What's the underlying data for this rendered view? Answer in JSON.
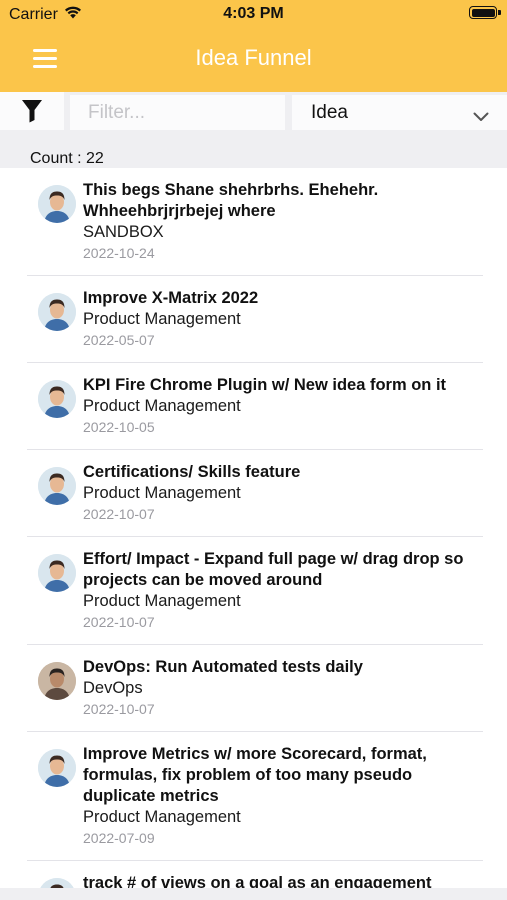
{
  "status_bar": {
    "carrier": "Carrier",
    "time": "4:03 PM"
  },
  "nav": {
    "title": "Idea Funnel",
    "menu_icon": "hamburger-menu-icon"
  },
  "filter": {
    "funnel_icon": "funnel-icon",
    "placeholder": "Filter...",
    "value": "",
    "type_selected": "Idea"
  },
  "count_text": "Count : 22",
  "ideas": [
    {
      "title": "This begs Shane shehrbrhs. Ehehehr. Whheehbrjrjrbejej where",
      "category": "SANDBOX",
      "date": "2022-10-24"
    },
    {
      "title": "Improve X-Matrix 2022",
      "category": "Product Management",
      "date": "2022-05-07"
    },
    {
      "title": "KPI Fire Chrome Plugin w/ New idea form on it",
      "category": "Product Management",
      "date": "2022-10-05"
    },
    {
      "title": "Certifications/ Skills feature",
      "category": "Product Management",
      "date": "2022-10-07"
    },
    {
      "title": "Effort/ Impact - Expand full page  w/ drag drop so projects can be moved around",
      "category": "Product Management",
      "date": "2022-10-07"
    },
    {
      "title": "DevOps: Run Automated tests daily",
      "category": "DevOps",
      "date": "2022-10-07"
    },
    {
      "title": "Improve Metrics w/ more Scorecard, format, formulas, fix problem of too many pseudo duplicate metrics",
      "category": "Product Management",
      "date": "2022-07-09"
    },
    {
      "title": "track # of views on a goal as an engagement",
      "category": "",
      "date": ""
    }
  ],
  "colors": {
    "header": "#fbc54a",
    "filter_bg": "#efeff2",
    "date": "#9a9aa0"
  }
}
